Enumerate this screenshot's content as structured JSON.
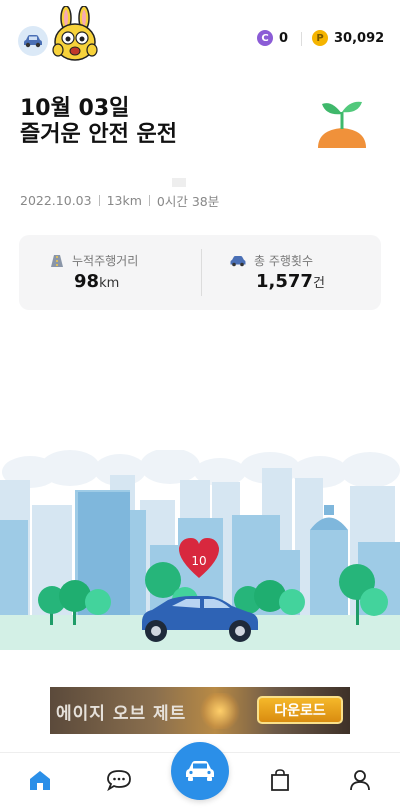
{
  "header": {
    "car_icon": "car-icon",
    "mascot": "rabbit-mascot",
    "coin_c_symbol": "C",
    "coin_c_value": "0",
    "coin_p_symbol": "P",
    "coin_p_value": "30,092",
    "colors": {
      "coin_c": "#8b5cd6",
      "coin_p": "#f5b400"
    }
  },
  "title": {
    "date": "10월 03일",
    "subtitle": "즐거운 안전 운전"
  },
  "trip_stats": {
    "date": "2022.10.03",
    "distance": "13km",
    "duration": "0시간 38분"
  },
  "summary_card": {
    "total_distance_label": "누적주행거리",
    "total_distance_value": "98",
    "total_distance_unit": "km",
    "total_trips_label": "총 주행횟수",
    "total_trips_value": "1,577",
    "total_trips_unit": "건"
  },
  "scene": {
    "heart_value": "10",
    "colors": {
      "car": "#2e63b5",
      "heart": "#d8283e",
      "tree": "#26b57a"
    }
  },
  "ad": {
    "title": "에이지 오브 제트",
    "button": "다운로드"
  },
  "nav": {
    "items": [
      "home-icon",
      "chat-icon",
      "drive-icon",
      "shop-icon",
      "profile-icon"
    ],
    "active_color": "#2b8fe8"
  }
}
